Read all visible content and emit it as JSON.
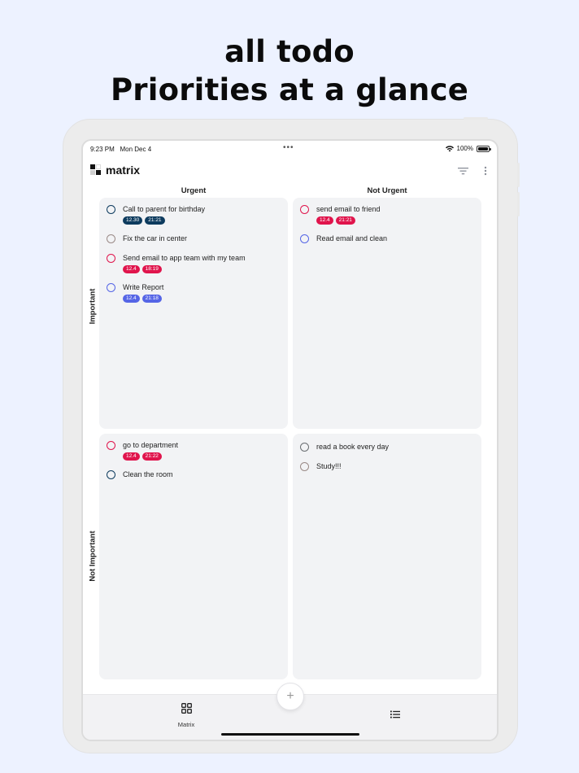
{
  "headline": {
    "line1": "all todo",
    "line2": "Priorities at a glance"
  },
  "status": {
    "time": "9:23 PM",
    "date": "Mon Dec 4",
    "dots": "•••",
    "battery": "100%"
  },
  "app": {
    "title": "matrix"
  },
  "columns": {
    "urgent": "Urgent",
    "not_urgent": "Not Urgent"
  },
  "rows": {
    "important": "Important",
    "not_important": "Not Important"
  },
  "colors": {
    "navy": "#0d3b5e",
    "crimson": "#e0144c",
    "indigo": "#5565e6",
    "gray_circle": "#9a8a86",
    "dark_circle": "#6a6e72"
  },
  "quadrants": {
    "urgent_important": [
      {
        "title": "Call to parent for birthday",
        "tags": [
          "12.30",
          "21:21"
        ]
      },
      {
        "title": "Fix the car in center",
        "tags": []
      },
      {
        "title": "Send email to app team with my team",
        "tags": [
          "12.4",
          "18:19"
        ]
      },
      {
        "title": "Write Report",
        "tags": [
          "12.4",
          "21:18"
        ]
      }
    ],
    "not_urgent_important": [
      {
        "title": "send email to friend",
        "tags": [
          "12.4",
          "21:21"
        ]
      },
      {
        "title": "Read email and clean",
        "tags": []
      }
    ],
    "urgent_not_important": [
      {
        "title": "go to department",
        "tags": [
          "12.4",
          "21:22"
        ]
      },
      {
        "title": "Clean the room",
        "tags": []
      }
    ],
    "not_urgent_not_important": [
      {
        "title": "read a book every day",
        "tags": []
      },
      {
        "title": "Study!!!",
        "tags": []
      }
    ]
  },
  "nav": {
    "matrix_label": "Matrix",
    "add_symbol": "+"
  }
}
